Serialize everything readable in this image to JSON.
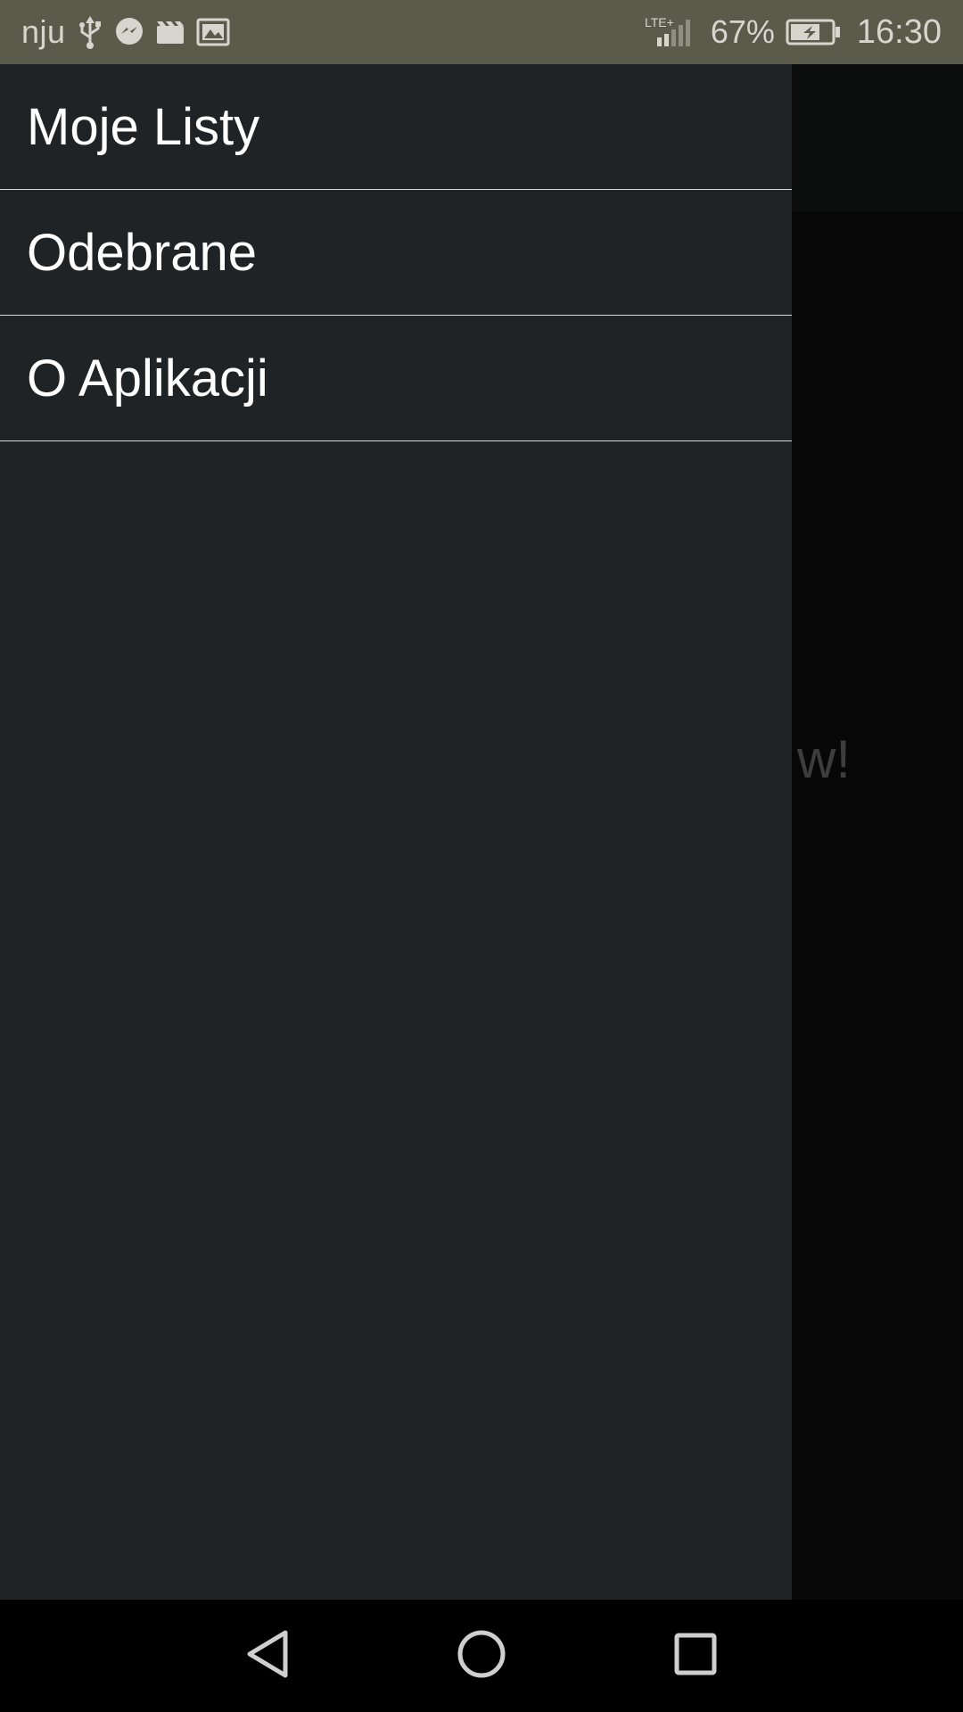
{
  "status_bar": {
    "carrier": "nju",
    "left_icons": [
      "usb-icon",
      "messenger-icon",
      "video-icon",
      "gallery-icon"
    ],
    "network": "LTE+",
    "battery_percent": "67%",
    "time": "16:30"
  },
  "background": {
    "partial_text": "w!"
  },
  "drawer": {
    "items": [
      {
        "label": "Moje Listy"
      },
      {
        "label": "Odebrane"
      },
      {
        "label": "O Aplikacji"
      }
    ]
  },
  "nav_bar": {
    "buttons": [
      "back-icon",
      "home-icon",
      "recents-icon"
    ]
  },
  "colors": {
    "status_bar": "#5a5b4b",
    "drawer": "#202325",
    "divider": "#d8d8d8"
  }
}
